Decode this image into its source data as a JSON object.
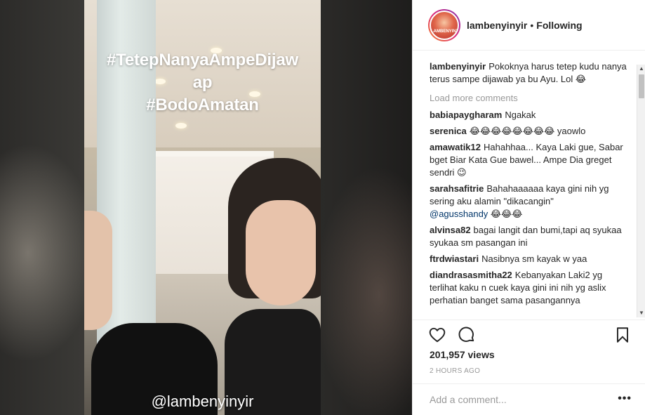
{
  "media": {
    "hashtag_line1": "#TetepNanyaAmpeDijaw",
    "hashtag_line2": "ap",
    "hashtag_line3": "#BodoAmatan",
    "watermark": "@lambenyinyir"
  },
  "header": {
    "username": "lambenyinyir",
    "separator": "•",
    "follow_status": "Following",
    "avatar_text": "LAMBENYINYIR"
  },
  "caption": {
    "user": "lambenyinyir",
    "text": "Pokoknya harus tetep kudu nanya terus sampe dijawab ya bu Ayu. Lol 😂"
  },
  "load_more_label": "Load more comments",
  "comments": [
    {
      "user": "babiapaygharam",
      "text": "Ngakak"
    },
    {
      "user": "serenica",
      "text": "😂😂😂😂😂😂😂😂 yaowlo"
    },
    {
      "user": "amawatik12",
      "text": "Hahahhaa... Kaya Laki gue, Sabar bget Biar Kata Gue bawel... Ampe Dia greget sendri 😉"
    },
    {
      "user": "sarahsafitrie",
      "text": "Bahahaaaaaa kaya gini nih yg sering aku alamin \"dikacangin\"",
      "mention": "@agusshandy",
      "suffix": " 😂😂😂"
    },
    {
      "user": "alvinsa82",
      "text": "bagai langit dan bumi,tapi aq syukaa syukaa sm pasangan ini"
    },
    {
      "user": "ftrdwiastari",
      "text": "Nasibnya sm kayak w yaa"
    },
    {
      "user": "diandrasasmitha22",
      "text": "Kebanyakan Laki2 yg terlihat kaku n cuek kaya gini ini nih yg aslix perhatian banget sama pasangannya"
    }
  ],
  "stats": {
    "views": "201,957 views",
    "time_ago": "2 HOURS AGO"
  },
  "add_comment": {
    "placeholder": "Add a comment...",
    "more_label": "•••"
  },
  "icons": {
    "like": "heart-icon",
    "comment": "comment-bubble-icon",
    "save": "bookmark-icon",
    "more": "more-options-icon"
  }
}
